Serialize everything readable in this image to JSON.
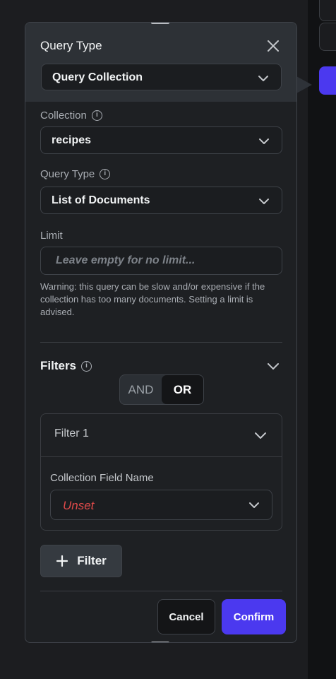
{
  "colors": {
    "accent": "#4b39ef",
    "panel_header": "#2d3136",
    "panel_bg": "#1e2023",
    "error": "#e04a4a"
  },
  "icons": {
    "close": "close-icon",
    "chevron": "chevron-down-icon",
    "info": "info-icon",
    "plus": "plus-icon"
  },
  "header": {
    "title": "Query Type",
    "query_type_value": "Query Collection"
  },
  "collection": {
    "label": "Collection",
    "value": "recipes"
  },
  "query_type": {
    "label": "Query Type",
    "value": "List of Documents"
  },
  "limit": {
    "label": "Limit",
    "placeholder": "Leave empty for no limit...",
    "value": "",
    "warning": "Warning: this query can be slow and/or expensive if the collection has too many documents. Setting a limit is advised."
  },
  "filters": {
    "title": "Filters",
    "logic_options": [
      "AND",
      "OR"
    ],
    "logic_selected": "OR",
    "items": [
      {
        "title": "Filter 1",
        "field_label": "Collection Field Name",
        "field_value": "Unset"
      }
    ],
    "add_label": "Filter"
  },
  "footer": {
    "cancel_label": "Cancel",
    "confirm_label": "Confirm"
  }
}
